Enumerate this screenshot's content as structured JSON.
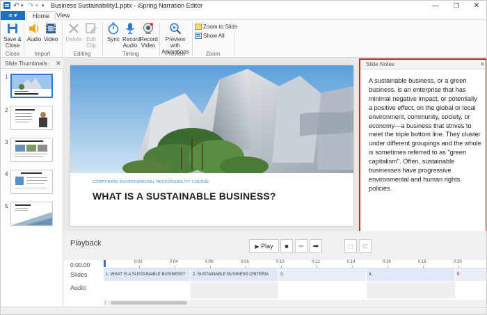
{
  "window": {
    "title": "Business Sustainability1.pptx - iSpring Narration Editor",
    "icons": [
      "undo-icon",
      "redo-icon",
      "minimize-icon",
      "maximize-icon",
      "close-icon"
    ]
  },
  "tabs": {
    "file_icon": "≡ ▾",
    "home": "Home",
    "view": "View"
  },
  "ribbon": {
    "save_close": "Save & Close",
    "group_close": "Close",
    "audio": "Audio",
    "video": "Video",
    "group_import": "Import",
    "delete": "Delete",
    "edit_clip": "Edit Clip",
    "group_editing": "Editing",
    "sync": "Sync",
    "record_audio": "Record Audio",
    "record_video": "Record Video",
    "group_timing": "Timing",
    "preview_animations": "Preview with Animations",
    "group_preview": "Preview",
    "zoom_to_slide": "Zoom to Slide",
    "show_all": "Show All",
    "group_zoom": "Zoom"
  },
  "thumbnails": {
    "title": "Slide Thumbnails",
    "items": [
      "1",
      "2",
      "3",
      "4",
      "5"
    ],
    "selected": 1
  },
  "slide": {
    "subtitle": "CORPORATE ENVIRONMENTAL RESPONSIBILITY COURSE",
    "title": "WHAT IS A SUSTAINABLE BUSINESS?"
  },
  "notes": {
    "title": "Slide Notes",
    "text": "A sustainable business, or a green business, is an enterprise that has minimal negative impact, or potentially a positive effect, on the global or local environment, community, society, or economy—a business that strives to meet the triple bottom line. They cluster under different groupings and the whole is sometimes referred to as \"green capitalism\". Often, sustainable businesses have progressive environmental and human rights policies."
  },
  "playback": {
    "title": "Playback",
    "play": "Play"
  },
  "timeline": {
    "time": "0:00.00",
    "slides_label": "Slides",
    "audio_label": "Audio",
    "ticks": [
      "0:02",
      "0:04",
      "0:06",
      "0:08",
      "0:10",
      "0:12",
      "0:14",
      "0:16",
      "0:18",
      "0:20"
    ],
    "segments": [
      "1. WHAT IS A SUSTAINABLE BUSINESS?",
      "2. SUSTAINABLE BUSINESS CRITERIA",
      "3.",
      "4.",
      "5."
    ]
  },
  "colors": {
    "accent": "#1f6fc0",
    "notes_border": "#d21d27",
    "slide_subtitle": "#2a8fd8",
    "segment": "#dfe8f6"
  }
}
